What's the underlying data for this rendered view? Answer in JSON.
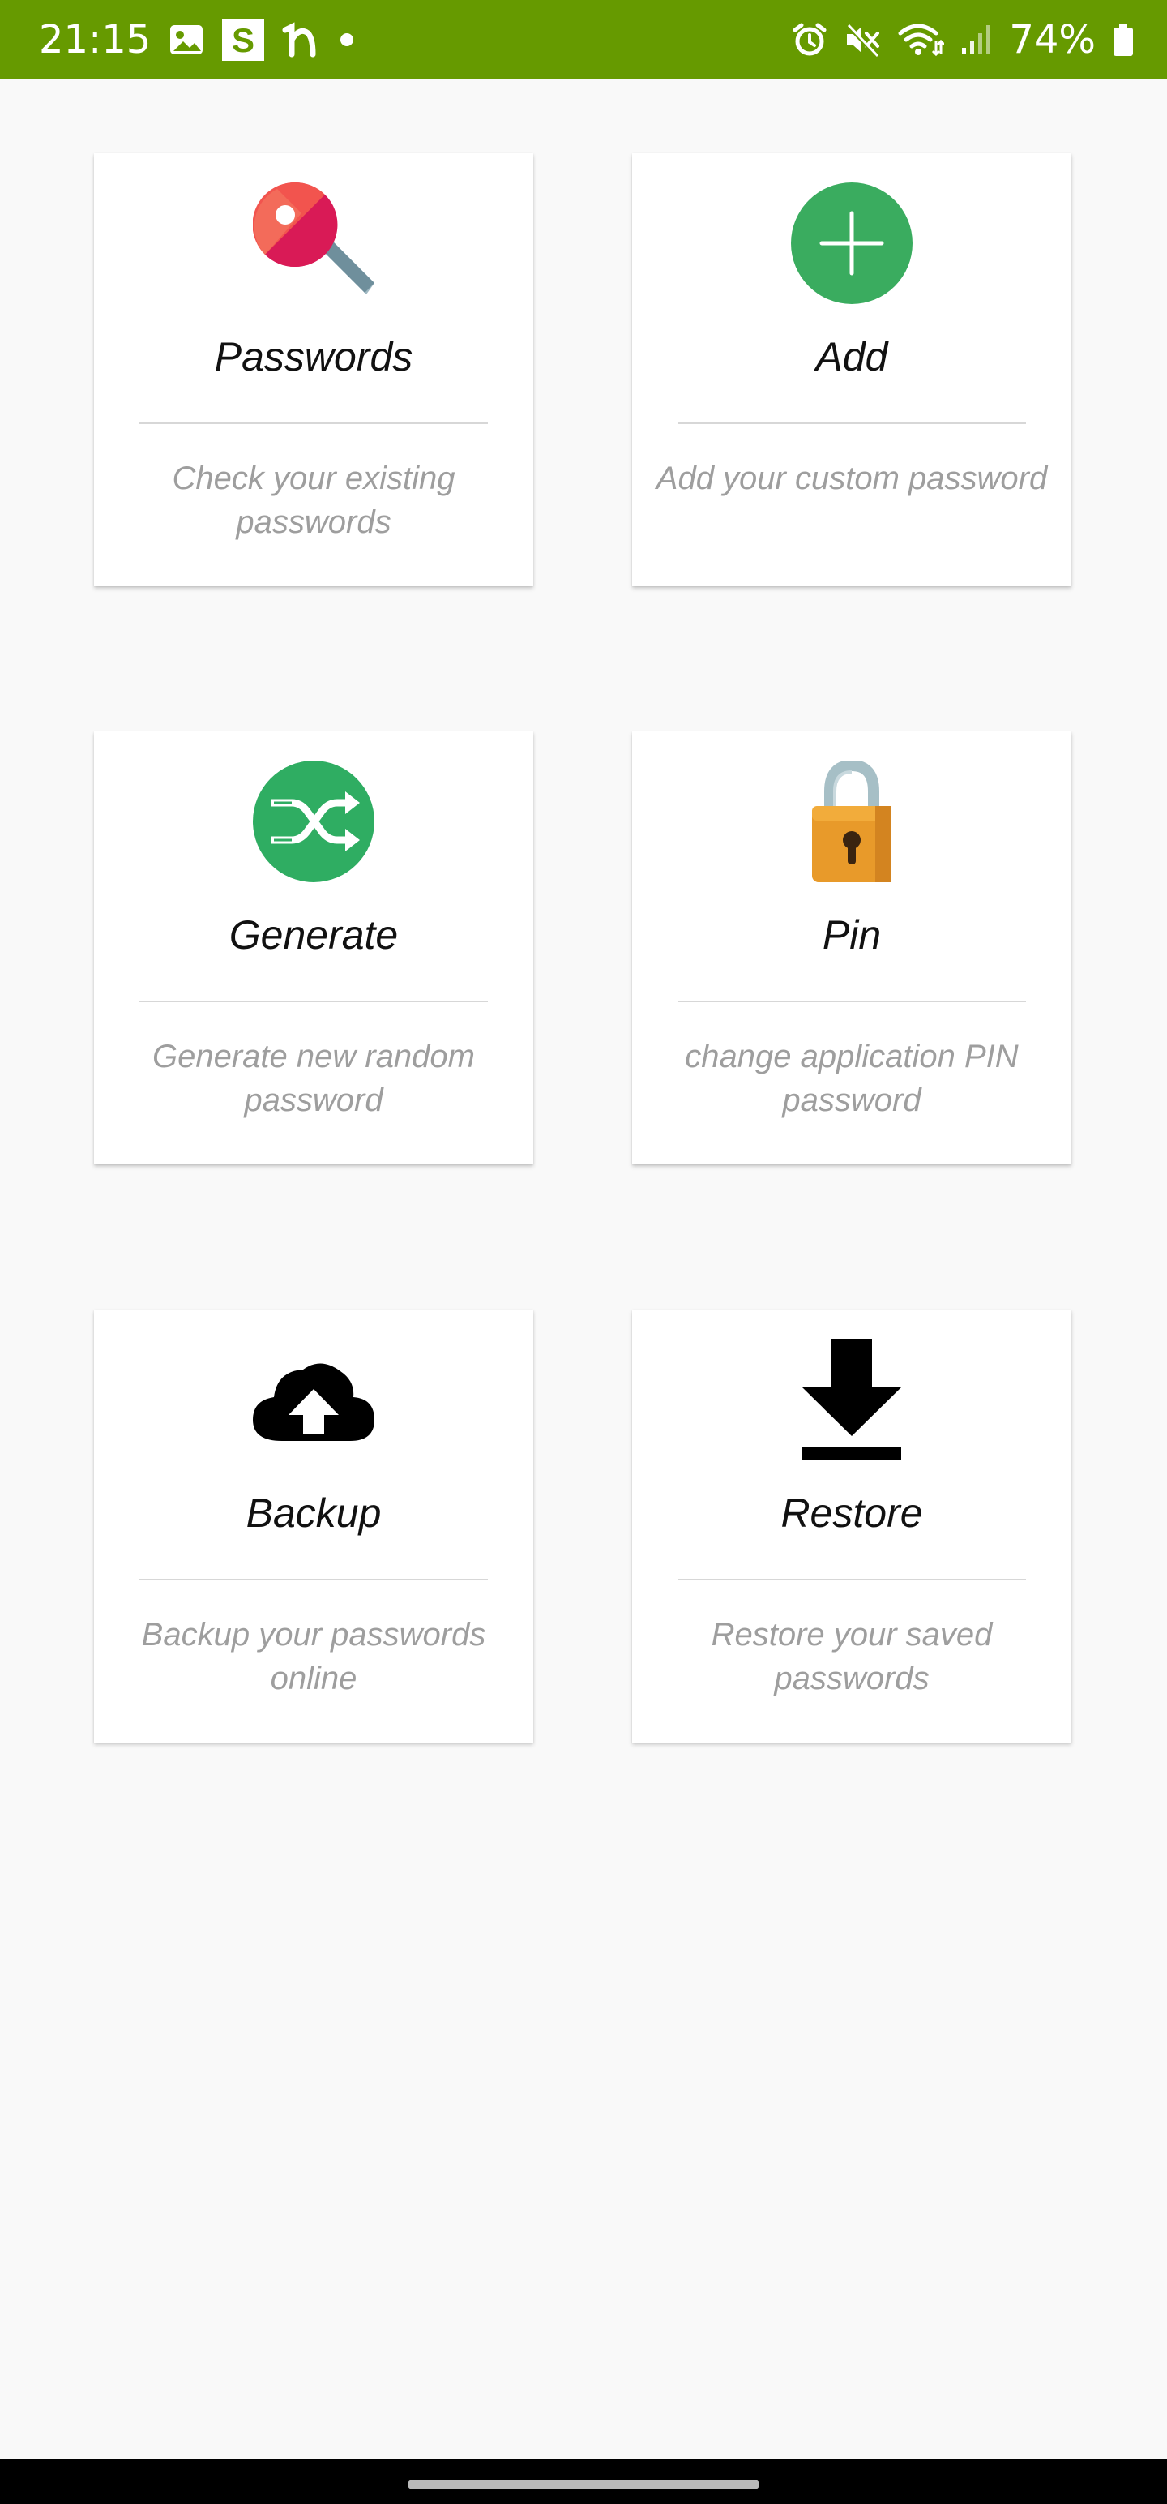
{
  "status_bar": {
    "time": "21:15",
    "battery": "74%",
    "left_icons": [
      "gallery-icon",
      "s-app-icon",
      "n-app-icon",
      "dot-icon"
    ],
    "right_icons": [
      "alarm-icon",
      "mute-icon",
      "wifi-icon",
      "signal-icon",
      "battery-icon"
    ],
    "color": "#669a00"
  },
  "cards": [
    {
      "id": "passwords",
      "title": "Passwords",
      "description": "Check your existing passwords",
      "icon": "key-icon"
    },
    {
      "id": "add",
      "title": "Add",
      "description": "Add your custom password",
      "icon": "plus-circle-icon"
    },
    {
      "id": "generate",
      "title": "Generate",
      "description": "Generate new random password",
      "icon": "shuffle-icon"
    },
    {
      "id": "pin",
      "title": "Pin",
      "description": "change application PIN password",
      "icon": "padlock-icon"
    },
    {
      "id": "backup",
      "title": "Backup",
      "description": "Backup your passwords online",
      "icon": "cloud-upload-icon"
    },
    {
      "id": "restore",
      "title": "Restore",
      "description": "Restore your saved passwords",
      "icon": "download-icon"
    }
  ],
  "colors": {
    "accent_green": "#3aac5f",
    "title_text": "#111111",
    "description_text": "#9e9e9e"
  }
}
